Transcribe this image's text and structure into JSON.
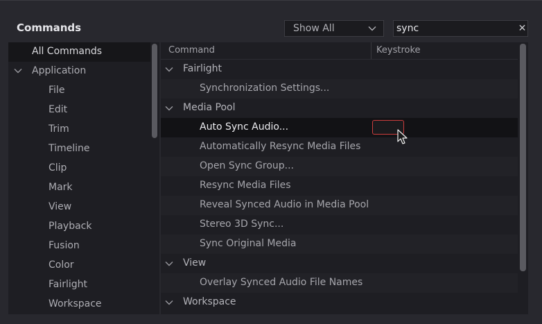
{
  "panel": {
    "title": "Commands"
  },
  "filter": {
    "selected": "Show All"
  },
  "search": {
    "value": "sync",
    "placeholder": "",
    "clear_glyph": "✕"
  },
  "left_tree": {
    "items": [
      {
        "label": "All Commands",
        "selected": true
      },
      {
        "label": "Application",
        "expanded": true
      },
      {
        "label": "File"
      },
      {
        "label": "Edit"
      },
      {
        "label": "Trim"
      },
      {
        "label": "Timeline"
      },
      {
        "label": "Clip"
      },
      {
        "label": "Mark"
      },
      {
        "label": "View"
      },
      {
        "label": "Playback"
      },
      {
        "label": "Fusion"
      },
      {
        "label": "Color"
      },
      {
        "label": "Fairlight"
      },
      {
        "label": "Workspace"
      }
    ]
  },
  "table": {
    "headers": {
      "command": "Command",
      "keystroke": "Keystroke"
    },
    "rows": [
      {
        "type": "group",
        "label": "Fairlight"
      },
      {
        "type": "item",
        "label": "Synchronization Settings..."
      },
      {
        "type": "group",
        "label": "Media Pool"
      },
      {
        "type": "item",
        "label": "Auto Sync Audio...",
        "highlighted": true,
        "editing_keystroke": true
      },
      {
        "type": "item",
        "label": "Automatically Resync Media Files"
      },
      {
        "type": "item",
        "label": "Open Sync Group..."
      },
      {
        "type": "item",
        "label": "Resync Media Files"
      },
      {
        "type": "item",
        "label": "Reveal Synced Audio in Media Pool"
      },
      {
        "type": "item",
        "label": "Stereo 3D Sync..."
      },
      {
        "type": "item",
        "label": "Sync Original Media"
      },
      {
        "type": "group",
        "label": "View"
      },
      {
        "type": "item",
        "label": "Overlay Synced Audio File Names"
      },
      {
        "type": "group",
        "label": "Workspace"
      }
    ]
  },
  "colors": {
    "background": "#28282e",
    "pane": "#1e1e23",
    "accent_red": "#cc3d3d"
  },
  "icons": {
    "expand": "chevron-down-icon",
    "clear": "close-icon",
    "pointer": "mouse-pointer-icon"
  }
}
